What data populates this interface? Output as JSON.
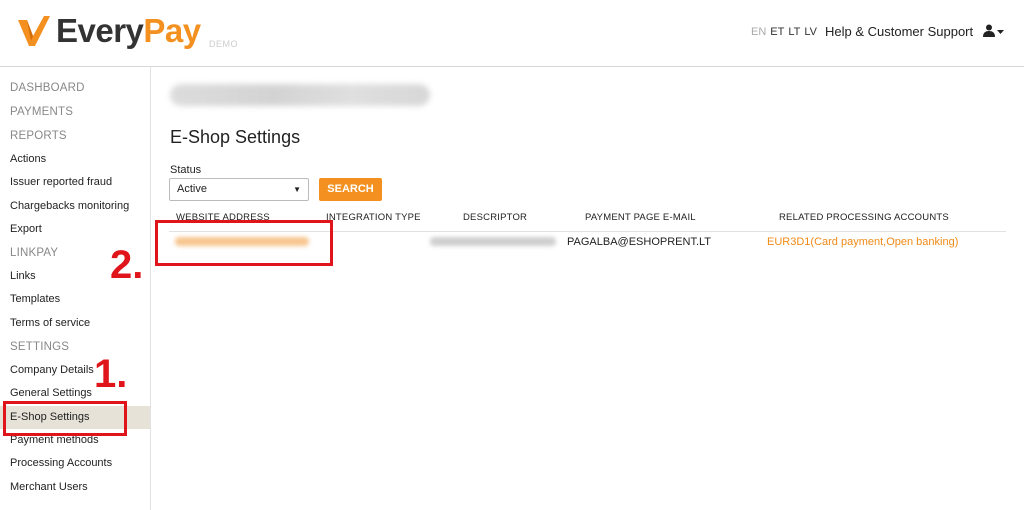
{
  "header": {
    "logo": {
      "brand_part1": "Every",
      "brand_part2": "Pay",
      "demo_tag": "DEMO",
      "accent_color": "#f39020"
    },
    "languages": [
      {
        "code": "EN",
        "active": true
      },
      {
        "code": "ET",
        "active": false
      },
      {
        "code": "LT",
        "active": false
      },
      {
        "code": "LV",
        "active": false
      }
    ],
    "help_link": "Help & Customer Support",
    "user_icon": "user-icon"
  },
  "sidebar": {
    "items": [
      {
        "label": "DASHBOARD",
        "type": "section"
      },
      {
        "label": "PAYMENTS",
        "type": "section"
      },
      {
        "label": "REPORTS",
        "type": "section"
      },
      {
        "label": "Actions",
        "type": "link"
      },
      {
        "label": "Issuer reported fraud",
        "type": "link"
      },
      {
        "label": "Chargebacks monitoring",
        "type": "link"
      },
      {
        "label": "Export",
        "type": "link"
      },
      {
        "label": "LINKPAY",
        "type": "section"
      },
      {
        "label": "Links",
        "type": "link"
      },
      {
        "label": "Templates",
        "type": "link"
      },
      {
        "label": "Terms of service",
        "type": "link"
      },
      {
        "label": "SETTINGS",
        "type": "section"
      },
      {
        "label": "Company Details",
        "type": "link"
      },
      {
        "label": "General Settings",
        "type": "link"
      },
      {
        "label": "E-Shop Settings",
        "type": "link",
        "selected": true
      },
      {
        "label": "Payment methods",
        "type": "link"
      },
      {
        "label": "Processing Accounts",
        "type": "link"
      },
      {
        "label": "Merchant Users",
        "type": "link"
      }
    ]
  },
  "main": {
    "page_title": "E-Shop Settings",
    "filter": {
      "status_label": "Status",
      "status_value": "Active",
      "search_label": "SEARCH"
    },
    "table": {
      "columns": [
        "WEBSITE ADDRESS",
        "INTEGRATION TYPE",
        "DESCRIPTOR",
        "PAYMENT PAGE E-MAIL",
        "RELATED PROCESSING ACCOUNTS"
      ],
      "rows": [
        {
          "payment_page_email": "PAGALBA@ESHOPRENT.LT",
          "related_accounts": "EUR3D1(Card payment,Open banking)"
        }
      ]
    }
  },
  "annotations": {
    "step1": "1.",
    "step2": "2.",
    "color": "#e0151b"
  }
}
